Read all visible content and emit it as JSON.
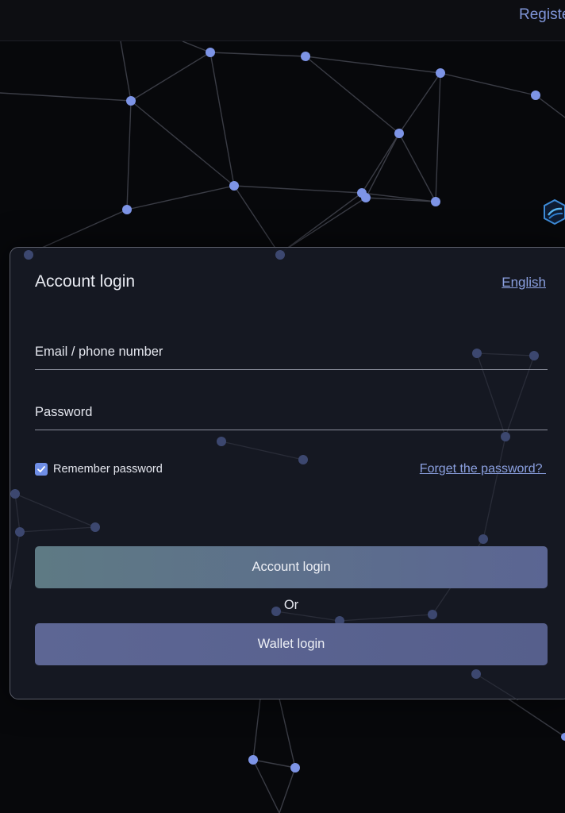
{
  "header": {
    "register_label": "Registe"
  },
  "login_card": {
    "title": "Account login",
    "language_label": "English",
    "email_placeholder": "Email / phone number",
    "password_placeholder": "Password",
    "remember_label": "Remember password",
    "remember_checked": true,
    "forget_label": "Forget the password? ",
    "account_login_label": "Account login",
    "or_label": "Or",
    "wallet_login_label": "Wallet login"
  },
  "colors": {
    "background": "#07080b",
    "accent_link": "#8ba0e0",
    "node": "#7d94e6",
    "card": "#161924"
  },
  "icons": {
    "checkbox": "check-icon",
    "logo": "hexagon-logo-icon"
  }
}
